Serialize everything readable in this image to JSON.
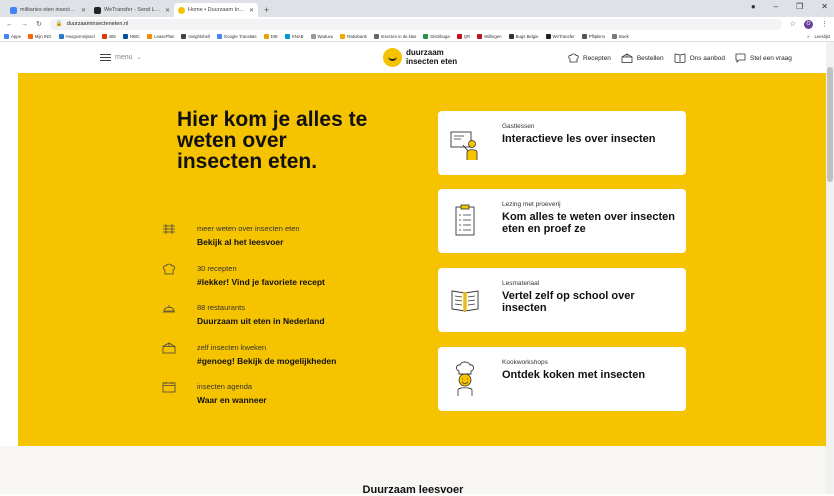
{
  "browser": {
    "tabs": [
      {
        "label": "militaries eten insecten - Google",
        "color": "#4285f4"
      },
      {
        "label": "WeTransfer - Send Large Files &",
        "color": "#222222"
      },
      {
        "label": "Home • Duurzaam Insecten Eten",
        "color": "#f5c200"
      }
    ],
    "new_tab": "+",
    "url": "duurzaaminsecteneten.nl",
    "avatar_letter": "O",
    "bookmarks": [
      {
        "label": "Apps",
        "color": "#4285f4"
      },
      {
        "label": "Mijn ING",
        "color": "#ff6200"
      },
      {
        "label": "Hoogvonnijssel",
        "color": "#2a78c8"
      },
      {
        "label": "365",
        "color": "#d83b01"
      },
      {
        "label": "NIBC",
        "color": "#00529b"
      },
      {
        "label": "LeasePlan",
        "color": "#f08a00"
      },
      {
        "label": "Insightshell",
        "color": "#444444"
      },
      {
        "label": "Google Translate",
        "color": "#4285f4"
      },
      {
        "label": "DIE",
        "color": "#e5a000"
      },
      {
        "label": "KNAB",
        "color": "#0099d6"
      },
      {
        "label": "Waduvu",
        "color": "#999999"
      },
      {
        "label": "Rabobank",
        "color": "#f5a300"
      },
      {
        "label": "Insecten in de klas",
        "color": "#666666"
      },
      {
        "label": "Distribuga",
        "color": "#2b9348"
      },
      {
        "label": "QR",
        "color": "#c1121f"
      },
      {
        "label": "Willingen",
        "color": "#c1121f"
      },
      {
        "label": "Bugs Belgie",
        "color": "#333333"
      },
      {
        "label": "WeTransfer",
        "color": "#222222"
      },
      {
        "label": "Pflipkinn",
        "color": "#555555"
      },
      {
        "label": "Boek",
        "color": "#7a7a7a"
      }
    ],
    "bookmarks_more": "»",
    "reading_list": "Leeslijst"
  },
  "header": {
    "menu_label": "menu",
    "logo_line1": "duurzaam",
    "logo_line2": "insecten eten",
    "nav": [
      {
        "label": "Recepten",
        "icon": "chef-hat-icon"
      },
      {
        "label": "Bestellen",
        "icon": "box-icon"
      },
      {
        "label": "Ons aanbod",
        "icon": "book-icon"
      },
      {
        "label": "Stel een vraag",
        "icon": "chat-bubble-icon"
      }
    ]
  },
  "hero": {
    "title": "Hier kom je alles te weten over insecten eten.",
    "bullets": [
      {
        "sub": "meer weten over insecten eten",
        "link": "Bekijk al het leesvoer",
        "icon": "leaves-icon"
      },
      {
        "sub": "30 recepten",
        "link": "#lekker! Vind je favoriete recept",
        "icon": "chef-hat-icon"
      },
      {
        "sub": "88 restaurants",
        "link": "Duurzaam uit eten in Nederland",
        "icon": "cloche-icon"
      },
      {
        "sub": "zelf insecten kweken",
        "link": "#genoeg! Bekijk de mogelijkheden",
        "icon": "box-icon"
      },
      {
        "sub": "insecten agenda",
        "link": "Waar en wanneer",
        "icon": "calendar-icon"
      }
    ],
    "cards": [
      {
        "kicker": "Gastlessen",
        "title": "Interactieve les over insecten",
        "icon": "teacher-icon"
      },
      {
        "kicker": "Lezing met proeverij",
        "title": "Kom alles te weten over insecten eten en proef ze",
        "icon": "clipboard-icon"
      },
      {
        "kicker": "Lesmateriaal",
        "title": "Vertel zelf op school over insecten",
        "icon": "open-book-icon"
      },
      {
        "kicker": "Kookworkshops",
        "title": "Ontdek koken met insecten",
        "icon": "chef-icon"
      }
    ]
  },
  "section": {
    "title": "Duurzaam leesvoer"
  },
  "colors": {
    "brand_yellow": "#f6c300",
    "text_dark": "#111111"
  }
}
